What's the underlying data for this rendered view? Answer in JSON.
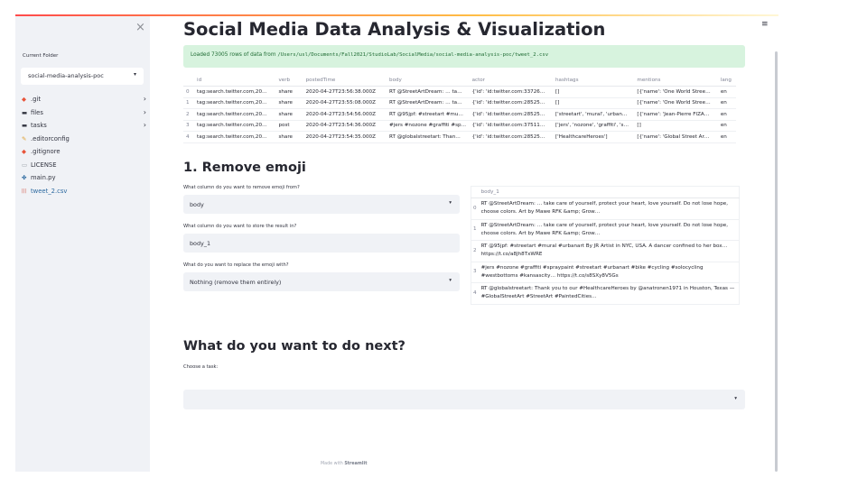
{
  "sidebar": {
    "close_icon": "×",
    "current_folder_label": "Current Folder",
    "folder_value": "social-media-analysis-poc",
    "items": [
      {
        "label": ".git",
        "icon": "git-icon",
        "glyph": "◆",
        "expandable": true
      },
      {
        "label": "files",
        "icon": "folder-icon",
        "glyph": "▬",
        "expandable": true
      },
      {
        "label": "tasks",
        "icon": "folder-icon",
        "glyph": "▬",
        "expandable": true
      },
      {
        "label": ".editorconfig",
        "icon": "editorconfig-icon",
        "glyph": "✎",
        "expandable": false
      },
      {
        "label": ".gitignore",
        "icon": "git-icon",
        "glyph": "◆",
        "expandable": false
      },
      {
        "label": "LICENSE",
        "icon": "license-icon",
        "glyph": "▭",
        "expandable": false
      },
      {
        "label": "main.py",
        "icon": "python-icon",
        "glyph": "✤",
        "expandable": false
      },
      {
        "label": "tweet_2.csv",
        "icon": "csv-icon",
        "glyph": "|||",
        "expandable": false
      }
    ]
  },
  "main": {
    "title": "Social Media Data Analysis & Visualization",
    "success_prefix": "Loaded 73005 rows of data from ",
    "success_path": "/Users/usl/Documents/Fall2021/StudioLab/SocialMedia/social-media-analysis-poc/tweet_2.csv",
    "dataframe": {
      "columns": [
        "",
        "id",
        "verb",
        "postedTime",
        "body",
        "actor",
        "hashtags",
        "mentions",
        "lang"
      ],
      "rows": [
        [
          "0",
          "tag:search.twitter.com,20…",
          "share",
          "2020-04-27T23:56:38.000Z",
          "RT @StreetArtDream: … ta…",
          "{'id': 'id:twitter.com:33726…",
          "[]",
          "[{'name': 'One World Stree…",
          "en"
        ],
        [
          "1",
          "tag:search.twitter.com,20…",
          "share",
          "2020-04-27T23:55:08.000Z",
          "RT @StreetArtDream: … ta…",
          "{'id': 'id:twitter.com:28525…",
          "[]",
          "[{'name': 'One World Stree…",
          "en"
        ],
        [
          "2",
          "tag:search.twitter.com,20…",
          "share",
          "2020-04-27T23:54:56.000Z",
          "RT @95jpf: #streetart #mu…",
          "{'id': 'id:twitter.com:28525…",
          "['streetart', 'mural', 'urban…",
          "[{'name': 'Jean-Pierre FIZA…",
          "en"
        ],
        [
          "3",
          "tag:search.twitter.com,20…",
          "post",
          "2020-04-27T23:54:36.000Z",
          "#jers #nozone #graffiti #sp…",
          "{'id': 'id:twitter.com:37511…",
          "['jers', 'nozone', 'graffiti', 's…",
          "[]",
          "en"
        ],
        [
          "4",
          "tag:search.twitter.com,20…",
          "share",
          "2020-04-27T23:54:35.000Z",
          "RT @globalstreetart: Than…",
          "{'id': 'id:twitter.com:28525…",
          "['HealthcareHeroes']",
          "[{'name': 'Global Street Ar…",
          "en"
        ]
      ]
    },
    "remove_emoji": {
      "heading": "1. Remove emoji",
      "q1_label": "What column do you want to remove emoji from?",
      "q1_value": "body",
      "q2_label": "What column do you want to store the result in?",
      "q2_value": "body_1",
      "q3_label": "What do you want to replace the emoji with?",
      "q3_value": "Nothing (remove them entirely)",
      "result_table": {
        "header": "body_1",
        "rows": [
          {
            "index": "0",
            "text": "RT @StreetArtDream: … take care of yourself, protect your heart, love yourself. Do not lose hope, choose colors. Art by Mawe RFK &amp; Grow…"
          },
          {
            "index": "1",
            "text": "RT @StreetArtDream: … take care of yourself, protect your heart, love yourself. Do not lose hope, choose colors. Art by Mawe RFK &amp; Grow…"
          },
          {
            "index": "2",
            "text": "RT @95jpf: #streetart #mural #urbanart By JR Artist in NYC, USA. A dancer confined to her box… https://t.co/a8Jh8TxWRE"
          },
          {
            "index": "3",
            "text": "#jers #nozone #graffiti #spraypaint #streetart #urbanart #bike #cycling #solocycling #westbottoms #kansascity… https://t.co/s8SXy8V5Gs"
          },
          {
            "index": "4",
            "text": "RT @globalstreetart: Thank you to our #HealthcareHeroes by @anatronen1971 in Houston, Texas — #GlobalStreetArt #StreetArt #PaintedCities…"
          }
        ]
      }
    },
    "next": {
      "heading": "What do you want to do next?",
      "task_label": "Choose a task:",
      "task_value": ""
    },
    "footer_prefix": "Made with ",
    "footer_brand": "Streamlit"
  },
  "menu_icon": "≡",
  "colors": {
    "sidebar_bg": "#f0f2f6",
    "success_bg": "#d7f3de",
    "success_text": "#1e6b33",
    "accent_red": "#ff4b4b"
  }
}
